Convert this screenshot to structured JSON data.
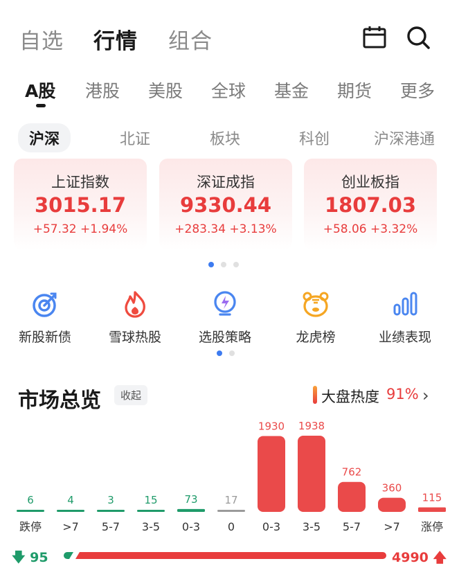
{
  "top_nav": {
    "tabs": [
      "自选",
      "行情",
      "组合"
    ],
    "active": "行情",
    "icons": [
      "calendar-icon",
      "search-icon"
    ]
  },
  "market_tabs": {
    "items": [
      "A股",
      "港股",
      "美股",
      "全球",
      "基金",
      "期货",
      "更多"
    ],
    "active": "A股"
  },
  "sub_tabs": {
    "items": [
      "沪深",
      "北证",
      "板块",
      "科创",
      "沪深港通"
    ],
    "active": "沪深"
  },
  "indices": [
    {
      "name": "上证指数",
      "value": "3015.17",
      "change": "+57.32 +1.94%"
    },
    {
      "name": "深证成指",
      "value": "9330.44",
      "change": "+283.34 +3.13%"
    },
    {
      "name": "创业板指",
      "value": "1807.03",
      "change": "+58.06 +3.32%"
    }
  ],
  "entries": [
    {
      "label": "新股新债",
      "icon": "target-icon"
    },
    {
      "label": "雪球热股",
      "icon": "flame-icon"
    },
    {
      "label": "选股策略",
      "icon": "bulb-icon"
    },
    {
      "label": "龙虎榜",
      "icon": "tiger-icon"
    },
    {
      "label": "业绩表现",
      "icon": "bar-chart-icon"
    }
  ],
  "overview": {
    "title": "市场总览",
    "collapse_label": "收起",
    "heat_label": "大盘热度",
    "heat_value": "91%",
    "chevron": "›"
  },
  "chart_data": {
    "type": "bar",
    "categories": [
      "跌停",
      ">7",
      "5-7",
      "3-5",
      "0-3",
      "0",
      "0-3",
      "3-5",
      "5-7",
      ">7",
      "涨停"
    ],
    "values": [
      6,
      4,
      3,
      15,
      73,
      17,
      1930,
      1938,
      762,
      360,
      115
    ],
    "colors": [
      "#1f9b6a",
      "#1f9b6a",
      "#1f9b6a",
      "#1f9b6a",
      "#1f9b6a",
      "#9a9a9a",
      "#ea4a4a",
      "#ea4a4a",
      "#ea4a4a",
      "#ea4a4a",
      "#ea4a4a"
    ]
  },
  "ratio": {
    "down": "95",
    "up": "4990",
    "down_value": 95,
    "up_value": 4990,
    "down_color": "#1f9b6a",
    "up_color": "#e83c3c"
  },
  "colors": {
    "up": "#e83c3c",
    "down": "#1f9b6a",
    "accent": "#3d7bf0"
  }
}
